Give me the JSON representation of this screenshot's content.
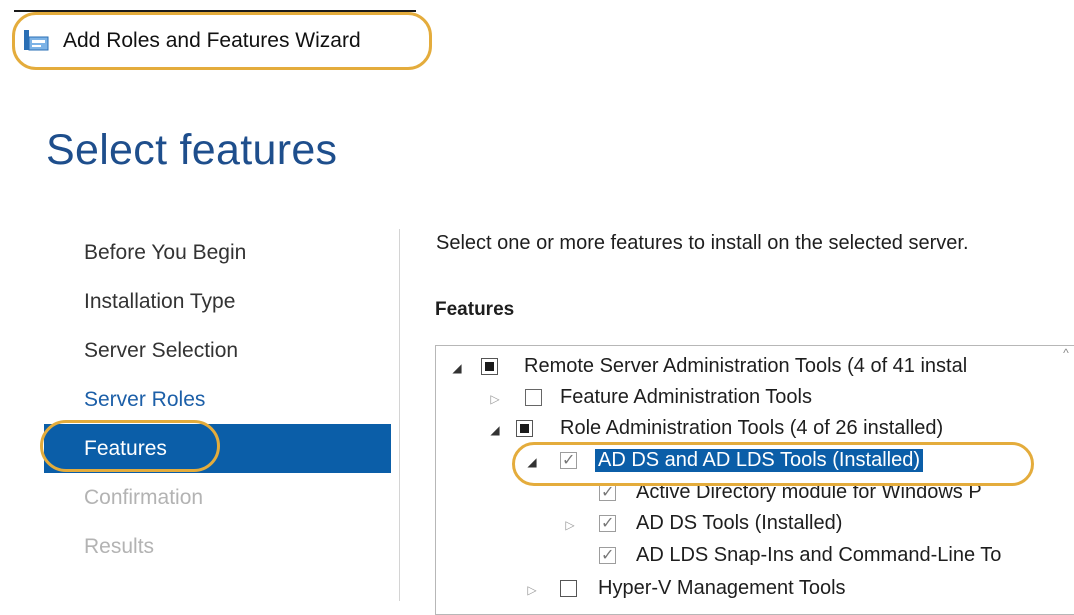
{
  "window": {
    "title": "Add Roles and Features Wizard",
    "icon": "server-wizard-icon"
  },
  "page": {
    "title": "Select features"
  },
  "nav": {
    "items": [
      {
        "label": "Before You Begin",
        "state": "normal"
      },
      {
        "label": "Installation Type",
        "state": "normal"
      },
      {
        "label": "Server Selection",
        "state": "normal"
      },
      {
        "label": "Server Roles",
        "state": "link"
      },
      {
        "label": "Features",
        "state": "active"
      },
      {
        "label": "Confirmation",
        "state": "disabled"
      },
      {
        "label": "Results",
        "state": "disabled"
      }
    ]
  },
  "main": {
    "instruction": "Select one or more features to install on the selected server.",
    "features_label": "Features"
  },
  "tree": {
    "rows": [
      {
        "label": "Remote Server Administration Tools (4 of 41 instal",
        "expander": "open",
        "checkbox": "partial"
      },
      {
        "label": "Feature Administration Tools",
        "expander": "closed",
        "checkbox": "unchecked"
      },
      {
        "label": "Role Administration Tools (4 of 26 installed)",
        "expander": "open",
        "checkbox": "partial"
      },
      {
        "label": "AD DS and AD LDS Tools (Installed)",
        "expander": "open",
        "checkbox": "checked",
        "selected": true
      },
      {
        "label": "Active Directory module for Windows P",
        "expander": "none",
        "checkbox": "checked"
      },
      {
        "label": "AD DS Tools (Installed)",
        "expander": "closed",
        "checkbox": "checked"
      },
      {
        "label": "AD LDS Snap-Ins and Command-Line To",
        "expander": "none",
        "checkbox": "checked"
      },
      {
        "label": "Hyper-V Management Tools",
        "expander": "closed",
        "checkbox": "unchecked"
      }
    ]
  },
  "colors": {
    "accent": "#0b5ea8",
    "title": "#1e4e8c",
    "highlight_ring": "#e4ac3c"
  }
}
